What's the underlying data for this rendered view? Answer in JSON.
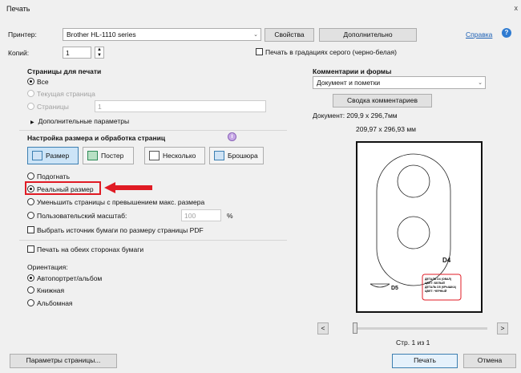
{
  "window": {
    "title": "Печать",
    "close_glyph": "x"
  },
  "printer": {
    "label": "Принтер:",
    "value": "Brother HL-1110 series",
    "properties_button": "Свойства",
    "advanced_button": "Дополнительно",
    "help_link": "Справка"
  },
  "copies": {
    "label": "Копий:",
    "value": "1",
    "grayscale_label": "Печать в градациях серого (черно-белая)"
  },
  "pages": {
    "title": "Страницы для печати",
    "all": "Все",
    "current": "Текущая страница",
    "pages": "Страницы",
    "pages_value": "1",
    "more_options": "Дополнительные параметры"
  },
  "sizing": {
    "title": "Настройка размера и обработка страниц",
    "buttons": [
      "Размер",
      "Постер",
      "Несколько",
      "Брошюра"
    ],
    "fit": "Подогнать",
    "actual_size": "Реальный размер",
    "shrink": "Уменьшить страницы с превышением макс. размера",
    "custom_scale": "Пользовательский масштаб:",
    "custom_scale_value": "100",
    "percent": "%",
    "paper_source": "Выбрать источник бумаги по размеру страницы PDF"
  },
  "duplex": {
    "label": "Печать на обеих сторонах бумаги"
  },
  "orientation": {
    "title": "Ориентация:",
    "auto": "Автопортрет/альбом",
    "portrait": "Книжная",
    "landscape": "Альбомная"
  },
  "comments": {
    "title": "Комментарии и формы",
    "value": "Документ и пометки",
    "summary_button": "Сводка комментариев"
  },
  "document": {
    "size_label": "Документ: 209,9 x 296,7мм",
    "page_size": "209,97 x 296,93 мм"
  },
  "preview": {
    "label_d4": "D4",
    "label_d5": "D5",
    "stamp_lines": [
      "ДЕТАЛЬ D4 (ОВАЛ)",
      "ЦВЕТ: БЕЛЫЙ",
      "ДЕТАЛЬ D5 (КРЫШКА)",
      "ЦВЕТ: ЧЕРНЫЙ"
    ],
    "prev": "<",
    "next": ">",
    "page_of": "Стр. 1 из 1"
  },
  "footer": {
    "page_setup_button": "Параметры страницы...",
    "print_button": "Печать",
    "cancel_button": "Отмена"
  },
  "colors": {
    "accent": "#3c7fb1",
    "highlight": "#e01b24",
    "link": "#1a5fb4"
  },
  "icons": [
    "help-icon",
    "dropdown-arrow-icon",
    "spinner-icon",
    "info-icon",
    "arrow-annotation-icon"
  ]
}
